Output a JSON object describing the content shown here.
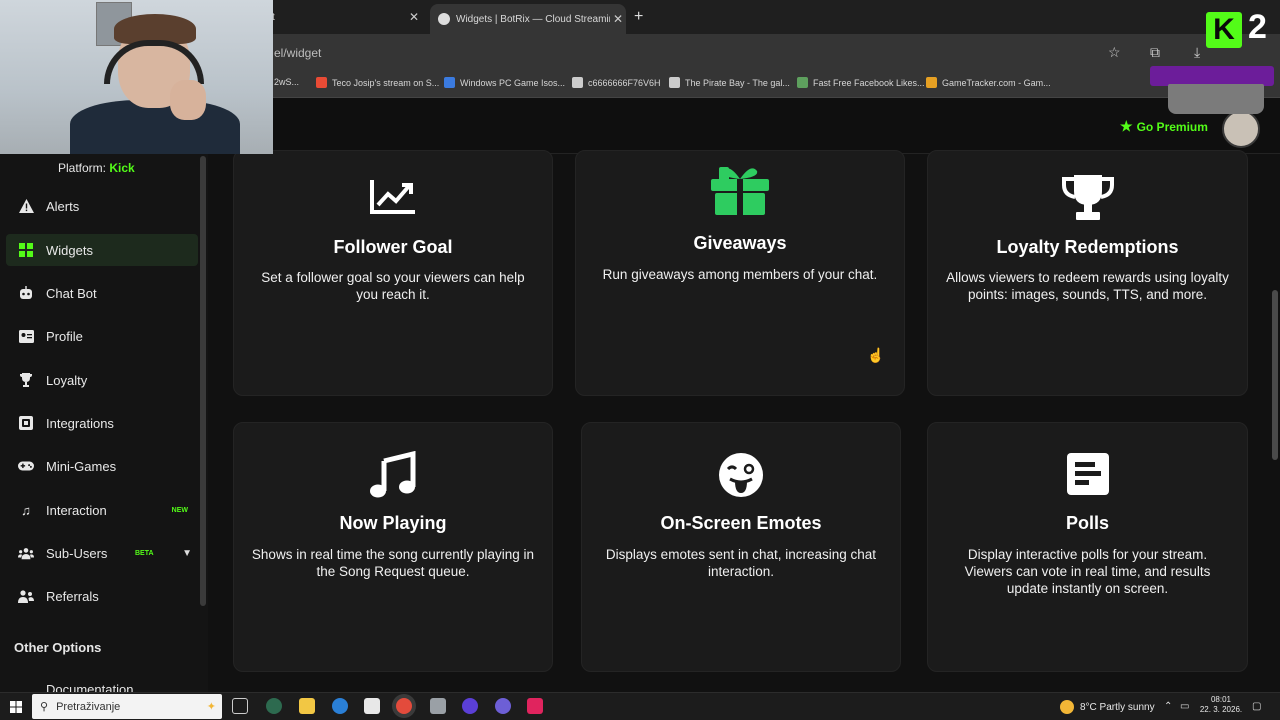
{
  "browser": {
    "tab_inactive_label": "t",
    "tab_active_label": "Widgets | BotRix — Cloud Streaming B",
    "new_tab_label": "+",
    "url": "el/widget",
    "bookmarks": [
      {
        "label": "2wS...",
        "color": "#777777"
      },
      {
        "label": "Teco Josip's stream on S...",
        "color": "#e94b35"
      },
      {
        "label": "Windows PC Game Isos...",
        "color": "#3b7be0"
      },
      {
        "label": "c6666666F76V6H",
        "color": "#cccccc"
      },
      {
        "label": "The Pirate Bay - The gal...",
        "color": "#cccccc"
      },
      {
        "label": "Fast Free Facebook Likes...",
        "color": "#5ea05e"
      },
      {
        "label": "GameTracker.com - Gam...",
        "color": "#e6a023"
      }
    ]
  },
  "header": {
    "premium_label": "Go Premium",
    "accent": "#53fc18"
  },
  "sidebar": {
    "platform_prefix": "Platform: ",
    "platform_name": "Kick",
    "items": [
      {
        "label": "Alerts",
        "icon": "warning-icon"
      },
      {
        "label": "Widgets",
        "icon": "widgets-icon",
        "active": true
      },
      {
        "label": "Chat Bot",
        "icon": "robot-icon"
      },
      {
        "label": "Profile",
        "icon": "profile-icon"
      },
      {
        "label": "Loyalty",
        "icon": "trophy-icon"
      },
      {
        "label": "Integrations",
        "icon": "integrations-icon"
      },
      {
        "label": "Mini-Games",
        "icon": "gamepad-icon"
      },
      {
        "label": "Interaction",
        "icon": "music-icon",
        "badge": "NEW"
      },
      {
        "label": "Sub-Users",
        "icon": "users-icon",
        "badge": "BETA"
      },
      {
        "label": "Referrals",
        "icon": "referrals-icon"
      }
    ],
    "other_options_label": "Other Options",
    "documentation_label": "Documentation"
  },
  "widgets": [
    {
      "title": "Follower Goal",
      "description": "Set a follower goal so your viewers can help you reach it.",
      "icon": "chart-line-icon"
    },
    {
      "title": "Giveaways",
      "description": "Run giveaways among members of your chat.",
      "icon": "gift-icon"
    },
    {
      "title": "Loyalty Redemptions",
      "description": "Allows viewers to redeem rewards using loyalty points: images, sounds, TTS, and more.",
      "icon": "trophy-icon"
    },
    {
      "title": "Now Playing",
      "description": "Shows in real time the song currently playing in the Song Request queue.",
      "icon": "music-note-icon"
    },
    {
      "title": "On-Screen Emotes",
      "description": "Displays emotes sent in chat, increasing chat interaction.",
      "icon": "tongue-emoji-icon"
    },
    {
      "title": "Polls",
      "description": "Display interactive polls for your stream. Viewers can vote in real time, and results update instantly on screen.",
      "icon": "poll-icon"
    }
  ],
  "overlay": {
    "k_label": "K",
    "number_label": "2"
  },
  "taskbar": {
    "search_placeholder": "Pretraživanje",
    "weather": "8°C  Partly sunny",
    "time": "08:01",
    "date": "22. 3. 2026."
  }
}
